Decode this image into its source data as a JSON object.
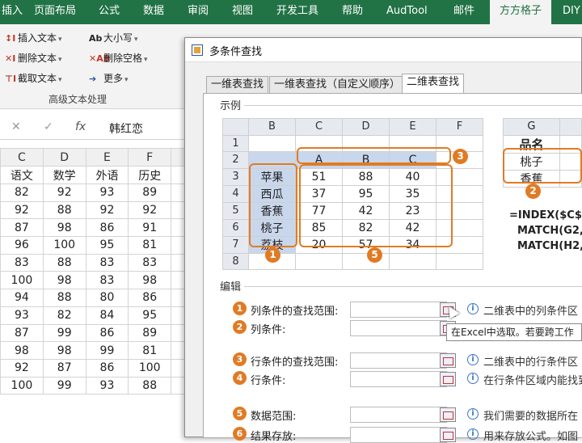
{
  "ribbon": {
    "tabs": [
      "插入",
      "页面布局",
      "公式",
      "数据",
      "审阅",
      "视图",
      "开发工具",
      "帮助",
      "AudTool",
      "邮件",
      "方方格子",
      "DIY"
    ],
    "active_tab": "方方格子",
    "buttons": [
      {
        "label": "插入文本",
        "icon": "insert-text-icon"
      },
      {
        "label": "删除文本",
        "icon": "delete-text-icon"
      },
      {
        "label": "截取文本",
        "icon": "extract-text-icon"
      },
      {
        "label": "大小写",
        "icon": "case-icon"
      },
      {
        "label": "删除空格",
        "icon": "delete-space-icon"
      },
      {
        "label": "更多",
        "icon": "more-arrow-icon"
      }
    ],
    "group_label": "高级文本处理"
  },
  "formula_bar": {
    "cancel": "✕",
    "confirm": "✓",
    "fx": "fx",
    "value": "韩红恋"
  },
  "sheet": {
    "col_headers": [
      "C",
      "D",
      "E",
      "F"
    ],
    "field_names": [
      "语文",
      "数学",
      "外语",
      "历史"
    ],
    "rows": [
      [
        82,
        92,
        93,
        89
      ],
      [
        92,
        88,
        92,
        92
      ],
      [
        87,
        98,
        86,
        91
      ],
      [
        96,
        100,
        95,
        81
      ],
      [
        83,
        88,
        83,
        83
      ],
      [
        100,
        98,
        83,
        98
      ],
      [
        94,
        88,
        80,
        86
      ],
      [
        93,
        82,
        84,
        95
      ],
      [
        87,
        99,
        86,
        89
      ],
      [
        98,
        98,
        99,
        81
      ],
      [
        92,
        87,
        86,
        100
      ],
      [
        100,
        99,
        93,
        88
      ]
    ]
  },
  "dialog": {
    "title": "多条件查找",
    "tabs": [
      "一维表查找",
      "一维表查找（自定义顺序）",
      "二维表查找"
    ],
    "active_tab": "二维表查找",
    "example_title": "示例",
    "example": {
      "col_headers": [
        "B",
        "C",
        "D",
        "E",
        "F"
      ],
      "row_numbers": [
        "1",
        "2",
        "3",
        "4",
        "5",
        "6",
        "7",
        "8"
      ],
      "col_labels": [
        "A",
        "B",
        "C"
      ],
      "row_labels": [
        "苹果",
        "西瓜",
        "香蕉",
        "桃子",
        "荔枝"
      ],
      "values": [
        [
          51,
          88,
          40
        ],
        [
          37,
          95,
          35
        ],
        [
          77,
          42,
          23
        ],
        [
          85,
          82,
          42
        ],
        [
          20,
          57,
          34
        ]
      ],
      "g_header": "G",
      "g_title": "品名",
      "g_items": [
        "桃子",
        "香蕉"
      ],
      "formula_lines": [
        "=INDEX($C$3:",
        "MATCH(G2,$",
        "MATCH(H2,$"
      ],
      "markers": [
        "1",
        "2",
        "3",
        "5"
      ]
    },
    "edit_title": "编辑",
    "fields": [
      {
        "num": "1",
        "label": "列条件的查找范围:",
        "desc": "二维表中的列条件区"
      },
      {
        "num": "2",
        "label": "列条件:",
        "desc": ""
      },
      {
        "num": "3",
        "label": "行条件的查找范围:",
        "desc": "二维表中的行条件区"
      },
      {
        "num": "4",
        "label": "行条件:",
        "desc": "在行条件区域内能找到"
      },
      {
        "num": "5",
        "label": "数据范围:",
        "desc": "我们需要的数据所在"
      },
      {
        "num": "6",
        "label": "结果存放:",
        "desc": "用来存放公式。如图"
      }
    ],
    "tooltip": "在Excel中选取。若要跨工作"
  },
  "colors": {
    "excel_green": "#217346",
    "accent_orange": "#e07b24",
    "header_blue": "#c9d7ec"
  }
}
